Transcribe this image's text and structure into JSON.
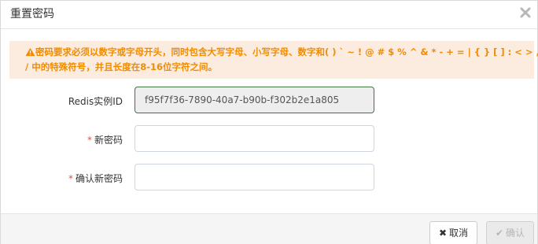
{
  "dialog": {
    "title": "重置密码",
    "close_icon": "close-icon"
  },
  "alert": {
    "icon": "warning-icon",
    "line1": "密码要求必须以数字或字母开头，同时包含大写字母、小写字母、数字和( ) ` ~ ! @ # $ % ^ & * - + = | { } [ ] : < > , . ?",
    "line2": "/ 中的特殊符号，并且长度在8-16位字符之间。",
    "color": "#f08c00",
    "background": "#fcebdf"
  },
  "form": {
    "instance_label": "Redis实例ID",
    "instance_value": "f95f7f36-7890-40a7-b90b-f302b2e1a805",
    "new_password_label": "新密码",
    "new_password_value": "",
    "confirm_password_label": "确认新密码",
    "confirm_password_value": "",
    "required_mark": "*"
  },
  "footer": {
    "cancel_label": "取消",
    "cancel_icon": "x-icon",
    "confirm_label": "确认",
    "confirm_icon": "check-icon"
  }
}
